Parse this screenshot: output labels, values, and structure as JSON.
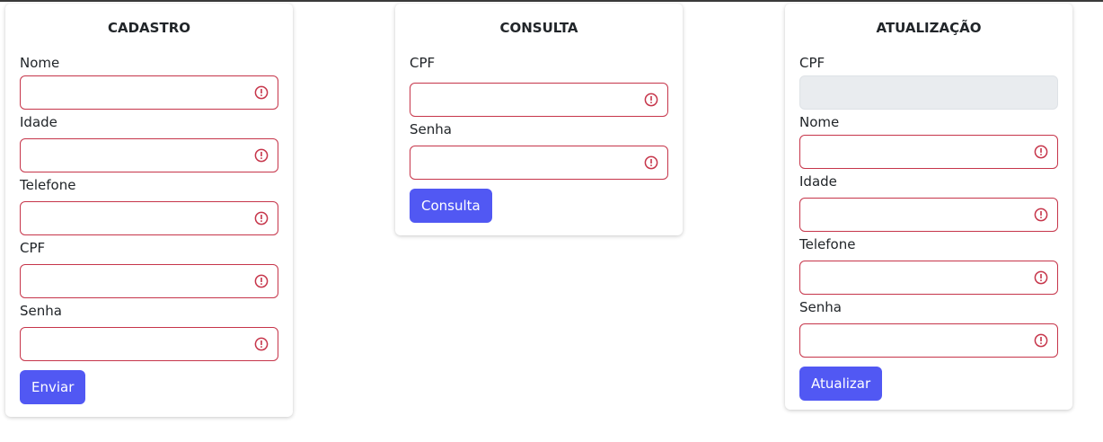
{
  "cadastro": {
    "title": "CADASTRO",
    "fields": [
      {
        "label": "Nome",
        "value": ""
      },
      {
        "label": "Idade",
        "value": ""
      },
      {
        "label": "Telefone",
        "value": ""
      },
      {
        "label": "CPF",
        "value": ""
      },
      {
        "label": "Senha",
        "value": ""
      }
    ],
    "button_label": "Enviar"
  },
  "consulta": {
    "title": "CONSULTA",
    "fields": [
      {
        "label": "CPF",
        "value": ""
      },
      {
        "label": "Senha",
        "value": ""
      }
    ],
    "button_label": "Consulta"
  },
  "atualizacao": {
    "title": "ATUALIZAÇÃO",
    "fields": [
      {
        "label": "CPF",
        "value": "",
        "disabled": true
      },
      {
        "label": "Nome",
        "value": ""
      },
      {
        "label": "Idade",
        "value": ""
      },
      {
        "label": "Telefone",
        "value": ""
      },
      {
        "label": "Senha",
        "value": ""
      }
    ],
    "button_label": "Atualizar"
  },
  "colors": {
    "accent": "#5158f3",
    "invalid_border": "#c6354a",
    "disabled_bg": "#e9ecef"
  },
  "icons": {
    "invalid": "error-circle-icon"
  }
}
